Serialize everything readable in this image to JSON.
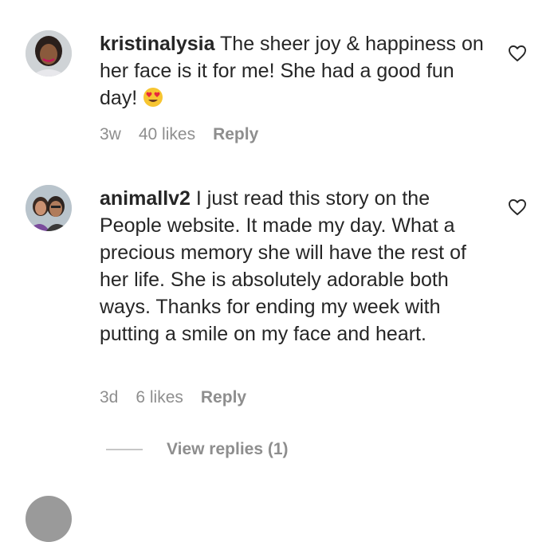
{
  "comments": [
    {
      "username": "kristinalysia",
      "text": "The sheer joy & happiness on her face is it for me! She had a good fun day!",
      "emoji": "heart-eyes-emoji",
      "time": "3w",
      "likes": "40 likes",
      "reply_label": "Reply"
    },
    {
      "username": "animallv2",
      "text": "I just read this story on the People website. It made my day. What a precious memory she will have the rest of her life. She is absolutely adorable both ways. Thanks for ending my week with putting a smile on my face and heart.",
      "time": "3d",
      "likes": "6 likes",
      "reply_label": "Reply"
    }
  ],
  "view_replies": {
    "label": "View replies (1)"
  },
  "icons": {
    "like": "heart-outline-icon",
    "emoji": "smiling-face-with-heart-eyes"
  },
  "colors": {
    "text": "#262626",
    "muted": "#8e8e8e",
    "divider": "#c7c7c7",
    "emoji_face": "#f7c531",
    "emoji_heart": "#e8283c"
  }
}
